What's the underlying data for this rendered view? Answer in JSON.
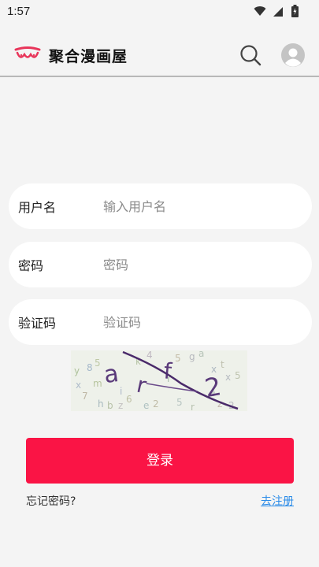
{
  "status_bar": {
    "time": "1:57",
    "icons": [
      "wifi-icon",
      "signal-icon",
      "battery-icon"
    ]
  },
  "app_bar": {
    "title": "聚合漫画屋",
    "logo_icon": "app-logo-icon",
    "search_icon": "search-icon",
    "avatar_icon": "user-avatar-icon"
  },
  "form": {
    "username": {
      "label": "用户名",
      "placeholder": "输入用户名",
      "value": ""
    },
    "password": {
      "label": "密码",
      "placeholder": "密码",
      "value": ""
    },
    "captcha": {
      "label": "验证码",
      "placeholder": "验证码",
      "value": ""
    },
    "captcha_image_text": "arf2"
  },
  "actions": {
    "login_label": "登录",
    "forgot_label": "忘记密码?",
    "register_label": "去注册"
  },
  "colors": {
    "primary": "#fa1445",
    "link": "#2c8ce8",
    "background": "#f4f4f4"
  }
}
